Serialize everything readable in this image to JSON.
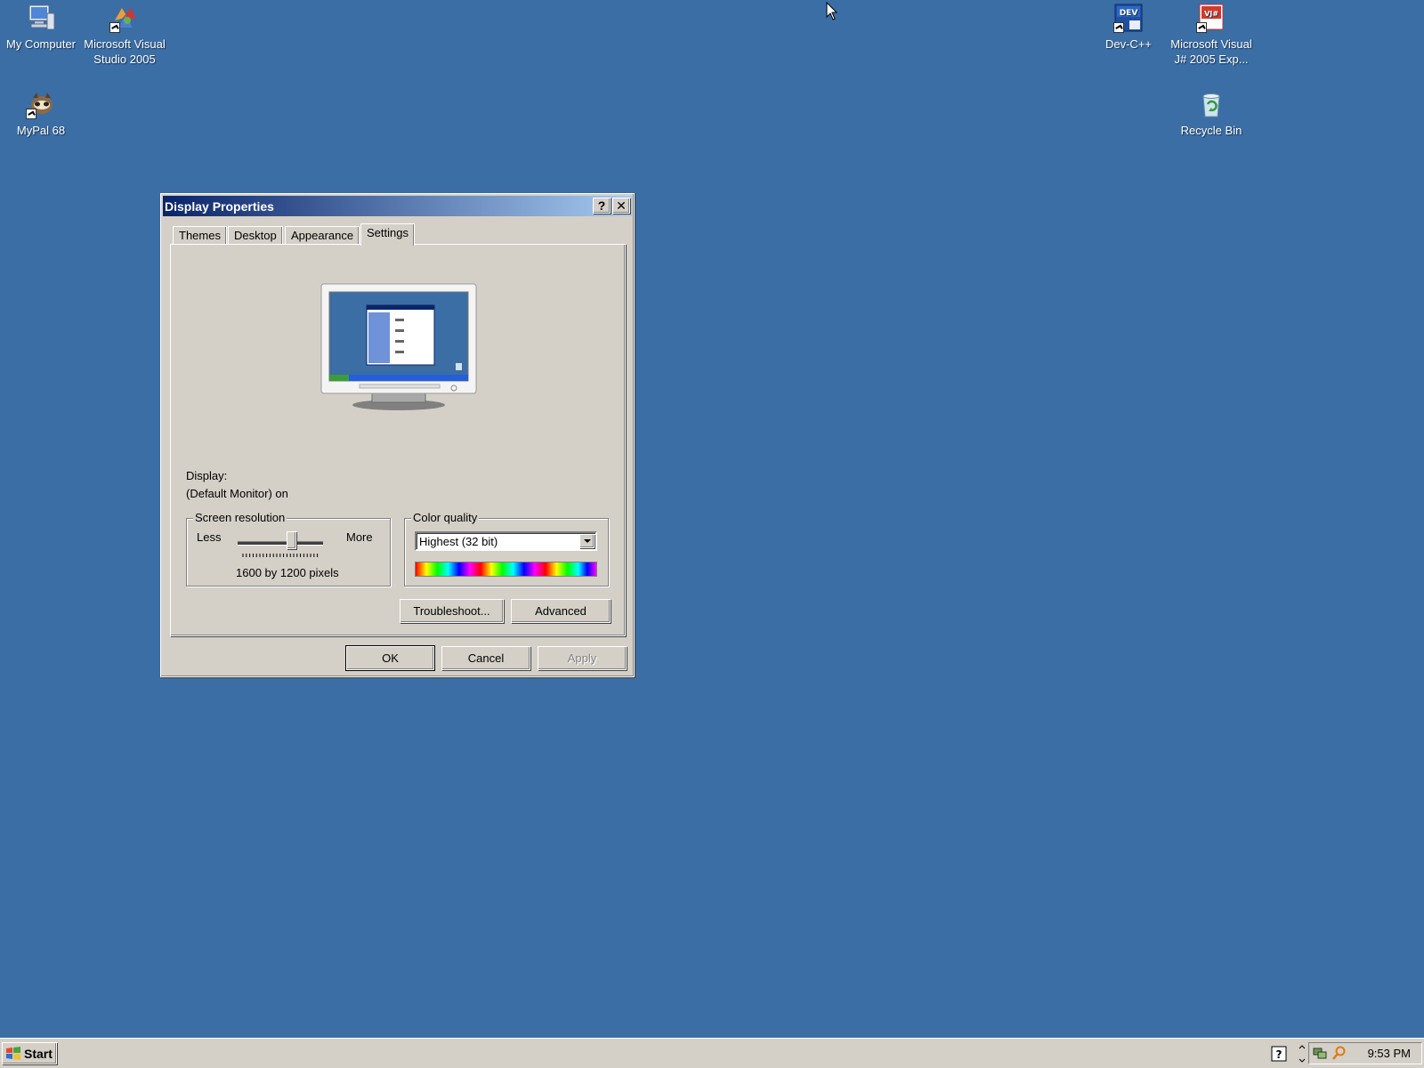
{
  "desktop": {
    "icons": [
      {
        "label": "My Computer",
        "icon": "my-computer-icon"
      },
      {
        "label": "Microsoft Visual Studio 2005",
        "icon": "visual-studio-icon"
      },
      {
        "label": "MyPal 68",
        "icon": "mypal-icon"
      },
      {
        "label": "Dev-C++",
        "icon": "devcpp-icon",
        "badge": "DEV"
      },
      {
        "label": "Microsoft Visual J# 2005 Exp...",
        "icon": "visual-jsharp-icon",
        "badge": "VJ#"
      },
      {
        "label": "Recycle Bin",
        "icon": "recycle-bin-icon"
      }
    ],
    "background_color": "#3a6ea5"
  },
  "dialog": {
    "title": "Display Properties",
    "help_label": "?",
    "close_label": "✕",
    "tabs": [
      {
        "label": "Themes",
        "active": false
      },
      {
        "label": "Desktop",
        "active": false
      },
      {
        "label": "Appearance",
        "active": false
      },
      {
        "label": "Settings",
        "active": true
      }
    ],
    "settings": {
      "display_label": "Display:",
      "display_value": "(Default Monitor) on",
      "resolution": {
        "group_label": "Screen resolution",
        "less_label": "Less",
        "more_label": "More",
        "value_text": "1600 by 1200 pixels",
        "slider_fraction": 0.65
      },
      "color_quality": {
        "group_label": "Color quality",
        "selected": "Highest (32 bit)"
      },
      "troubleshoot_label": "Troubleshoot...",
      "advanced_label": "Advanced"
    },
    "buttons": {
      "ok": "OK",
      "cancel": "Cancel",
      "apply": "Apply"
    }
  },
  "taskbar": {
    "start_label": "Start",
    "clock": "9:53 PM"
  }
}
